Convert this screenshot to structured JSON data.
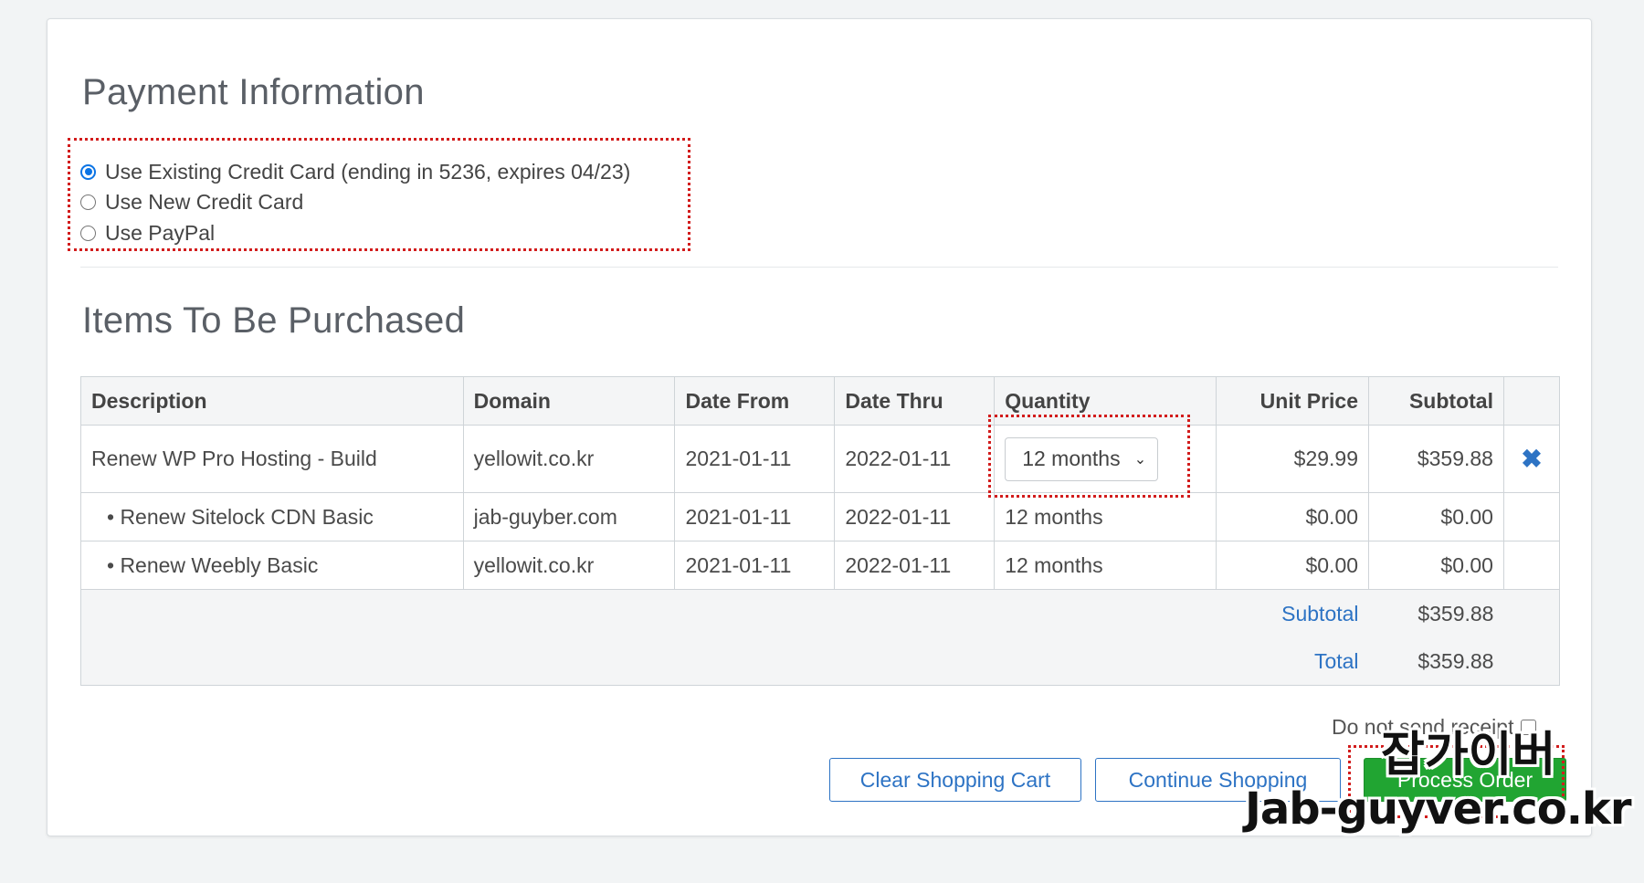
{
  "payment": {
    "title": "Payment Information",
    "options": [
      {
        "label": "Use Existing Credit Card (ending in 5236, expires 04/23)",
        "selected": true
      },
      {
        "label": "Use New Credit Card",
        "selected": false
      },
      {
        "label": "Use PayPal",
        "selected": false
      }
    ]
  },
  "items": {
    "title": "Items To Be Purchased",
    "columns": [
      "Description",
      "Domain",
      "Date From",
      "Date Thru",
      "Quantity",
      "Unit Price",
      "Subtotal"
    ],
    "rows": [
      {
        "description": "Renew WP Pro Hosting - Build",
        "domain": "yellowit.co.kr",
        "date_from": "2021-01-11",
        "date_thru": "2022-01-11",
        "quantity": "12 months",
        "unit_price": "$29.99",
        "subtotal": "$359.88"
      },
      {
        "description": "• Renew Sitelock CDN Basic",
        "domain": "jab-guyber.com",
        "date_from": "2021-01-11",
        "date_thru": "2022-01-11",
        "quantity": "12 months",
        "unit_price": "$0.00",
        "subtotal": "$0.00"
      },
      {
        "description": "• Renew Weebly Basic",
        "domain": "yellowit.co.kr",
        "date_from": "2021-01-11",
        "date_thru": "2022-01-11",
        "quantity": "12 months",
        "unit_price": "$0.00",
        "subtotal": "$0.00"
      }
    ],
    "totals": {
      "subtotal_label": "Subtotal",
      "subtotal_value": "$359.88",
      "total_label": "Total",
      "total_value": "$359.88"
    }
  },
  "receipt_label": "Do not send receipt",
  "buttons": {
    "clear": "Clear Shopping Cart",
    "continue": "Continue Shopping",
    "process": "Process Order"
  },
  "watermark": {
    "korean": "잡가이버",
    "site": "Jab-guyver.co.kr"
  },
  "colors": {
    "accent_blue": "#2d73c4",
    "radio_blue": "#0b74e5",
    "process_green": "#21a532",
    "highlight_red": "#d21c1c"
  },
  "icons": {
    "remove": "close-icon",
    "select": "chevron-down-icon"
  }
}
